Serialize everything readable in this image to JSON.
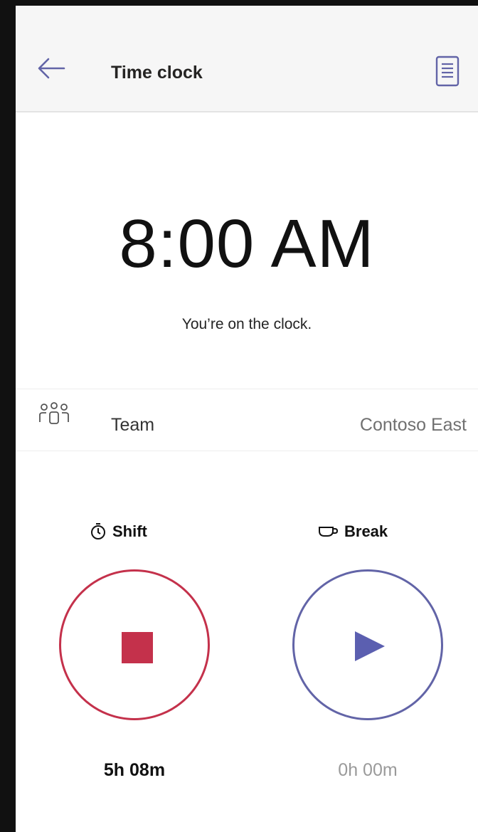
{
  "header": {
    "title": "Time clock",
    "back_icon": "arrow-left-icon",
    "doc_icon": "document-icon"
  },
  "clock": {
    "time": "8:00 AM",
    "status": "You’re on the clock."
  },
  "team": {
    "icon": "people-team-icon",
    "label": "Team",
    "value": "Contoso East"
  },
  "shift": {
    "icon": "timer-icon",
    "label": "Shift",
    "control_icon": "stop-icon",
    "duration": "5h 08m",
    "color": "#c4314b"
  },
  "break": {
    "icon": "cup-icon",
    "label": "Break",
    "control_icon": "play-icon",
    "duration": "0h 00m",
    "color": "#6264a7"
  },
  "colors": {
    "accent": "#6264a7",
    "danger": "#c4314b"
  }
}
